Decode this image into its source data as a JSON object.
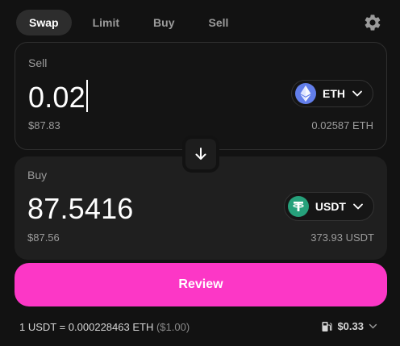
{
  "tabs": [
    {
      "label": "Swap",
      "active": true
    },
    {
      "label": "Limit",
      "active": false
    },
    {
      "label": "Buy",
      "active": false
    },
    {
      "label": "Sell",
      "active": false
    }
  ],
  "icons": {
    "settings": "gear-icon",
    "swap_direction": "arrow-down-icon",
    "gas": "gas-pump-icon",
    "dropdown": "chevron-down-icon"
  },
  "sell": {
    "label": "Sell",
    "amount": "0.02",
    "fiat": "$87.83",
    "balance": "0.02587 ETH",
    "token": {
      "symbol": "ETH",
      "icon": "eth-icon",
      "color": "#627eea"
    }
  },
  "buy": {
    "label": "Buy",
    "amount": "87.5416",
    "fiat": "$87.56",
    "balance": "373.93 USDT",
    "token": {
      "symbol": "USDT",
      "icon": "tether-icon",
      "color": "#26a17b"
    }
  },
  "review_button": "Review",
  "rate": {
    "text": "1 USDT = 0.000228463 ETH",
    "fiat": "($1.00)"
  },
  "gas": {
    "fee": "$0.33"
  },
  "colors": {
    "accent": "#fc37c6",
    "background": "#121212",
    "card": "#1f1f1f"
  }
}
